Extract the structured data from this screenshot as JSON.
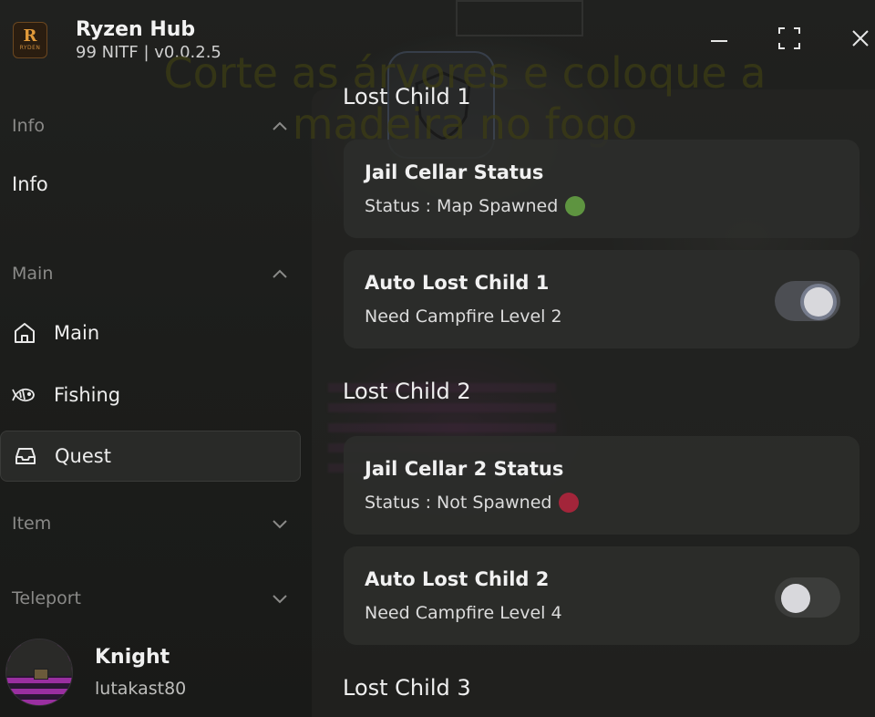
{
  "app": {
    "title": "Ryzen Hub",
    "subtitle": "99 NITF | v0.0.2.5",
    "logo_letter": "R",
    "logo_text": "RYDEN"
  },
  "overlay_text": "Corte as árvores e coloque a madeira no fogo",
  "window_controls": [
    "minimize-icon",
    "maximize-icon",
    "close-icon"
  ],
  "sidebar": {
    "sections": [
      {
        "label": "Info",
        "expanded": true,
        "items": [
          {
            "label": "Info",
            "icon": null
          }
        ]
      },
      {
        "label": "Main",
        "expanded": true,
        "items": [
          {
            "label": "Main",
            "icon": "home-icon"
          },
          {
            "label": "Fishing",
            "icon": "fish-icon"
          },
          {
            "label": "Quest",
            "icon": "inbox-icon",
            "active": true
          }
        ]
      },
      {
        "label": "Item",
        "expanded": false,
        "items": []
      },
      {
        "label": "Teleport",
        "expanded": false,
        "items": []
      }
    ]
  },
  "profile": {
    "name": "Knight",
    "username": "lutakast80"
  },
  "content": {
    "sections": [
      {
        "title": "Lost Child 1",
        "cards": [
          {
            "title": "Jail Cellar Status",
            "desc": "Status : Map Spawned",
            "status_color": "#5e9440"
          },
          {
            "title": "Auto Lost Child 1",
            "desc": "Need Campfire Level 2",
            "toggle": true
          }
        ]
      },
      {
        "title": "Lost Child 2",
        "cards": [
          {
            "title": "Jail Cellar 2 Status",
            "desc": "Status : Not Spawned",
            "status_color": "#a3253a"
          },
          {
            "title": "Auto Lost Child 2",
            "desc": "Need Campfire Level 4",
            "toggle": false
          }
        ]
      },
      {
        "title": "Lost Child 3",
        "cards": []
      }
    ]
  },
  "colors": {
    "accent_active_toggle": "#4c4e53",
    "status_spawned": "#5e9440",
    "status_not_spawned": "#a3253a"
  }
}
